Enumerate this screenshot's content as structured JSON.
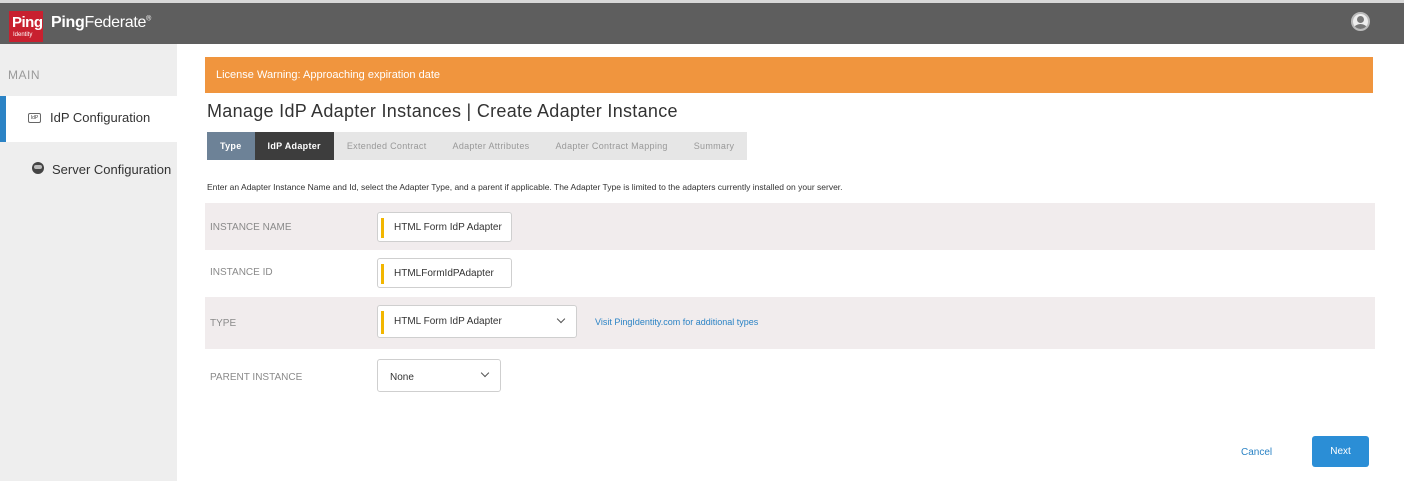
{
  "brand": {
    "logo_text": "Ping",
    "logo_sub": "Identity",
    "product_bold": "Ping",
    "product_light": "Federate",
    "product_mark": "®"
  },
  "sidebar": {
    "section": "MAIN",
    "items": [
      {
        "label": "IdP Configuration",
        "icon": "idp-icon",
        "icon_text": "IdP",
        "active": true
      },
      {
        "label": "Server Configuration",
        "icon": "server-icon",
        "active": false
      }
    ]
  },
  "warning": {
    "text": "License Warning: Approaching expiration date",
    "color": "#f0953e"
  },
  "page_title": "Manage IdP Adapter Instances | Create Adapter Instance",
  "tabs": [
    {
      "label": "Type",
      "state": "done"
    },
    {
      "label": "IdP Adapter",
      "state": "current"
    },
    {
      "label": "Extended Contract",
      "state": "pending"
    },
    {
      "label": "Adapter Attributes",
      "state": "pending"
    },
    {
      "label": "Adapter Contract Mapping",
      "state": "pending"
    },
    {
      "label": "Summary",
      "state": "pending"
    }
  ],
  "instructions": "Enter an Adapter Instance Name and Id, select the Adapter Type, and a parent if applicable. The Adapter Type is limited to the adapters currently installed on your server.",
  "form": {
    "instance_name": {
      "label": "INSTANCE NAME",
      "value": "HTML Form IdP Adapter"
    },
    "instance_id": {
      "label": "INSTANCE ID",
      "value": "HTMLFormIdPAdapter"
    },
    "type": {
      "label": "TYPE",
      "value": "HTML Form IdP Adapter",
      "link": "Visit PingIdentity.com for additional types"
    },
    "parent_instance": {
      "label": "PARENT INSTANCE",
      "value": "None"
    }
  },
  "actions": {
    "cancel": "Cancel",
    "next": "Next"
  },
  "colors": {
    "accent": "#2b83c5",
    "required": "#f2b600",
    "topbar": "#5e5e5e"
  }
}
